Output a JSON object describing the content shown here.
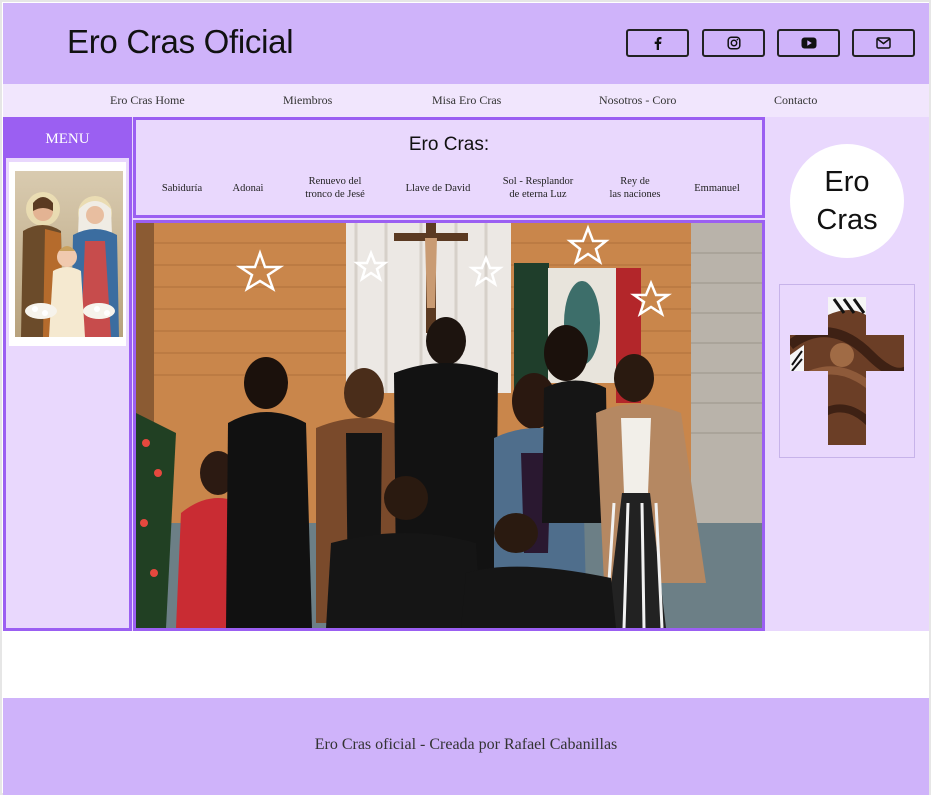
{
  "header": {
    "title": "Ero Cras Oficial",
    "social": [
      {
        "name": "facebook-icon"
      },
      {
        "name": "instagram-icon"
      },
      {
        "name": "youtube-icon"
      },
      {
        "name": "mail-icon"
      }
    ]
  },
  "nav": {
    "items": [
      "Ero Cras Home",
      "Miembros",
      "Misa Ero Cras",
      "Nosotros - Coro",
      "Contacto"
    ]
  },
  "sidebar": {
    "menu_label": "MENU",
    "image_icon": "holy-family-image"
  },
  "topics": {
    "title": "Ero Cras:",
    "items": [
      {
        "line1": "Sabiduría",
        "line2": ""
      },
      {
        "line1": "Adonai",
        "line2": ""
      },
      {
        "line1": "Renuevo del",
        "line2": "tronco de Jesé"
      },
      {
        "line1": "Llave de David",
        "line2": ""
      },
      {
        "line1": "Sol  - Resplandor",
        "line2": "de eterna Luz"
      },
      {
        "line1": "Rey de",
        "line2": "las naciones"
      },
      {
        "line1": "Emmanuel",
        "line2": ""
      }
    ]
  },
  "main": {
    "photo_icon": "group-photo"
  },
  "right": {
    "badge_line1": "Ero",
    "badge_line2": "Cras",
    "cross_icon": "cross-image"
  },
  "footer": {
    "text": "Ero Cras oficial - Creada por Rafael Cabanillas"
  },
  "colors": {
    "header_bg": "#cfb3fa",
    "nav_bg": "#f1e6fd",
    "content_bg": "#e9d8fd",
    "accent": "#9b5ff2"
  }
}
